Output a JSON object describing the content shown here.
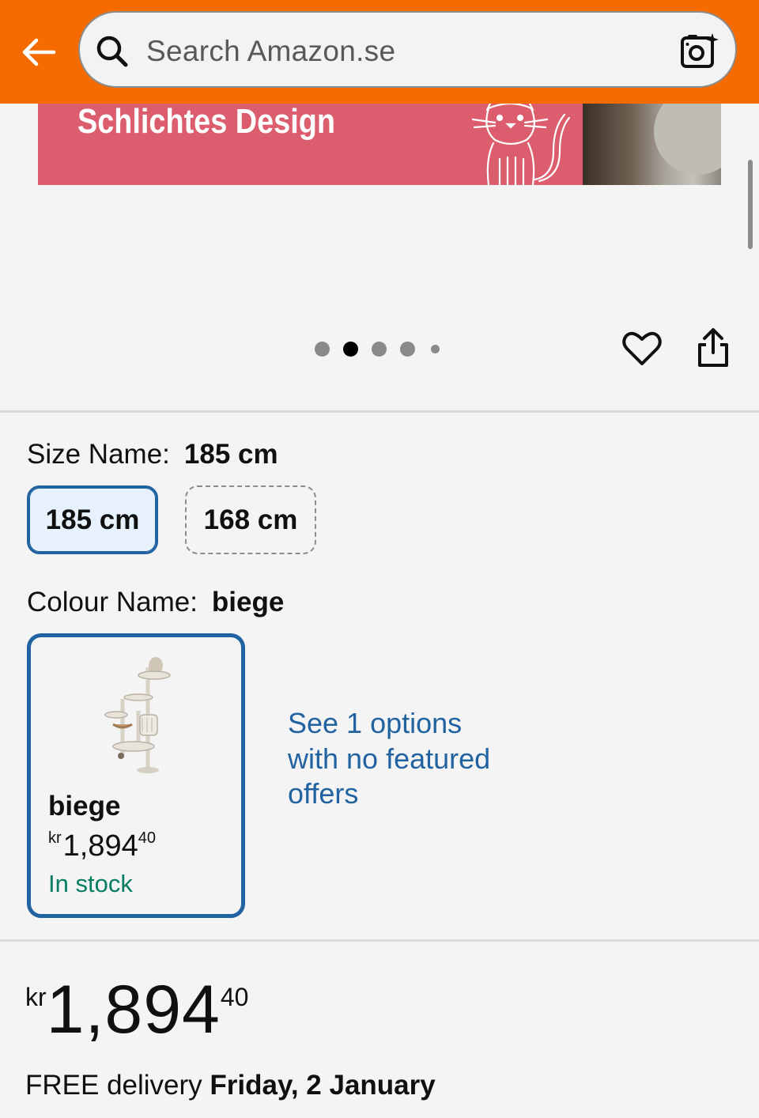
{
  "header": {
    "search_placeholder": "Search Amazon.se",
    "icons": {
      "back": "arrow-left-icon",
      "search": "search-icon",
      "camera": "camera-sparkle-icon"
    },
    "colors": {
      "background": "#f56b00"
    }
  },
  "hero": {
    "text": "Schlichtes Design",
    "background": "#db5d6e"
  },
  "carousel": {
    "dot_count": 5,
    "active_index": 1,
    "icons": {
      "wishlist": "heart-icon",
      "share": "share-icon"
    }
  },
  "size": {
    "label": "Size Name:",
    "selected_value": "185 cm",
    "options": [
      "185 cm",
      "168 cm"
    ]
  },
  "colour": {
    "label": "Colour Name:",
    "selected_value": "biege",
    "card": {
      "name": "biege",
      "price_currency": "kr",
      "price_whole": "1,894",
      "price_fraction": "40",
      "stock": "In stock"
    },
    "see_options_text": "See 1 options with no featured offers"
  },
  "price": {
    "currency": "kr",
    "whole": "1,894",
    "fraction": "40"
  },
  "delivery": {
    "prefix": "FREE delivery",
    "date": "Friday, 2 January"
  },
  "colors": {
    "accent_blue": "#2162a1",
    "in_stock_green": "#067d62",
    "selected_bg": "#e6f1fc"
  }
}
